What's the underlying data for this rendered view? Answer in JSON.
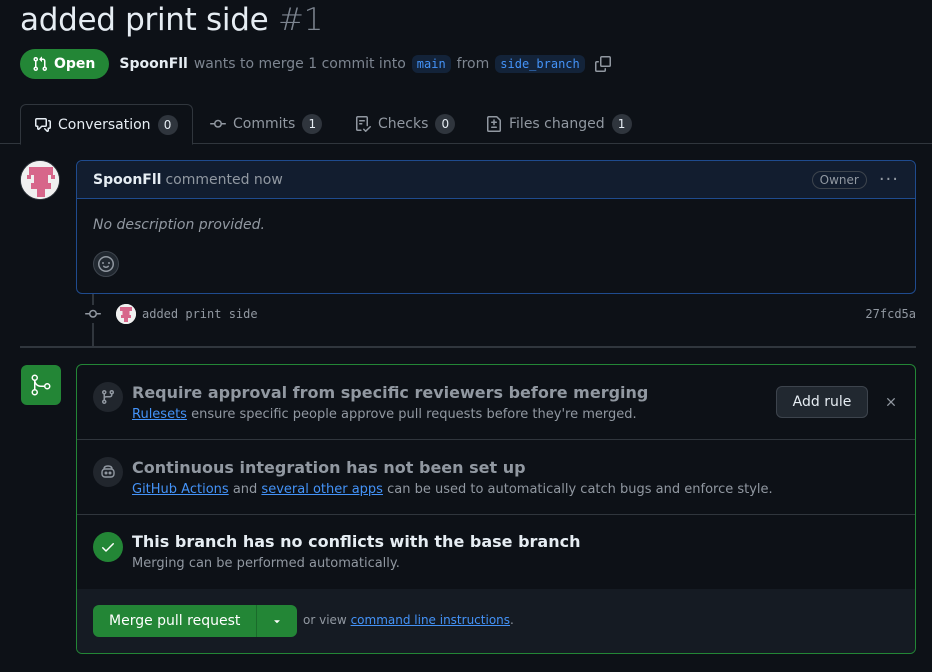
{
  "header": {
    "title": "added print side",
    "number": "#1",
    "status": "Open",
    "author": "SpoonFll",
    "merge_text": "wants to merge 1 commit into",
    "base_branch": "main",
    "from_text": "from",
    "head_branch": "side_branch"
  },
  "tabs": [
    {
      "label": "Conversation",
      "count": "0",
      "icon": "comment-discussion-icon"
    },
    {
      "label": "Commits",
      "count": "1",
      "icon": "git-commit-icon"
    },
    {
      "label": "Checks",
      "count": "0",
      "icon": "checklist-icon"
    },
    {
      "label": "Files changed",
      "count": "1",
      "icon": "file-diff-icon"
    }
  ],
  "comment": {
    "author": "SpoonFll",
    "timestamp": "commented now",
    "role_badge": "Owner",
    "menu": "···",
    "body": "No description provided."
  },
  "commit": {
    "message": "added print side",
    "sha": "27fcd5a"
  },
  "merge": {
    "review": {
      "title": "Require approval from specific reviewers before merging",
      "link": "Rulesets",
      "desc": "ensure specific people approve pull requests before they're merged.",
      "button": "Add rule"
    },
    "ci": {
      "title": "Continuous integration has not been set up",
      "link1": "GitHub Actions",
      "and": "and",
      "link2": "several other apps",
      "desc": "can be used to automatically catch bugs and enforce style."
    },
    "conflicts": {
      "title": "This branch has no conflicts with the base branch",
      "desc": "Merging can be performed automatically."
    },
    "merge_button": "Merge pull request",
    "or_view": "or view",
    "cli_link": "command line instructions",
    "period": "."
  },
  "colors": {
    "accent_green": "#238636",
    "link_blue": "#4493f8",
    "background": "#0d1117"
  }
}
